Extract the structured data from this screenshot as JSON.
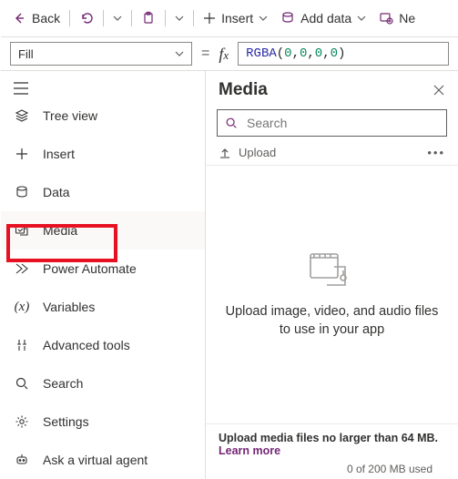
{
  "topbar": {
    "back": "Back",
    "insert": "Insert",
    "add_data": "Add data",
    "new": "Ne"
  },
  "prop": {
    "selected": "Fill",
    "formula_fn": "RGBA",
    "formula_args": [
      "0",
      "0",
      "0",
      "0"
    ]
  },
  "sidebar": {
    "items": [
      {
        "label": "Tree view"
      },
      {
        "label": "Insert"
      },
      {
        "label": "Data"
      },
      {
        "label": "Media"
      },
      {
        "label": "Power Automate"
      },
      {
        "label": "Variables"
      },
      {
        "label": "Advanced tools"
      },
      {
        "label": "Search"
      },
      {
        "label": "Settings"
      },
      {
        "label": "Ask a virtual agent"
      }
    ]
  },
  "panel": {
    "title": "Media",
    "search_placeholder": "Search",
    "upload_label": "Upload",
    "empty_msg": "Upload image, video, and audio files to use in your app",
    "footer_hint": "Upload media files no larger than 64 MB.",
    "learn_more": "Learn more",
    "quota": "0 of 200 MB used"
  }
}
